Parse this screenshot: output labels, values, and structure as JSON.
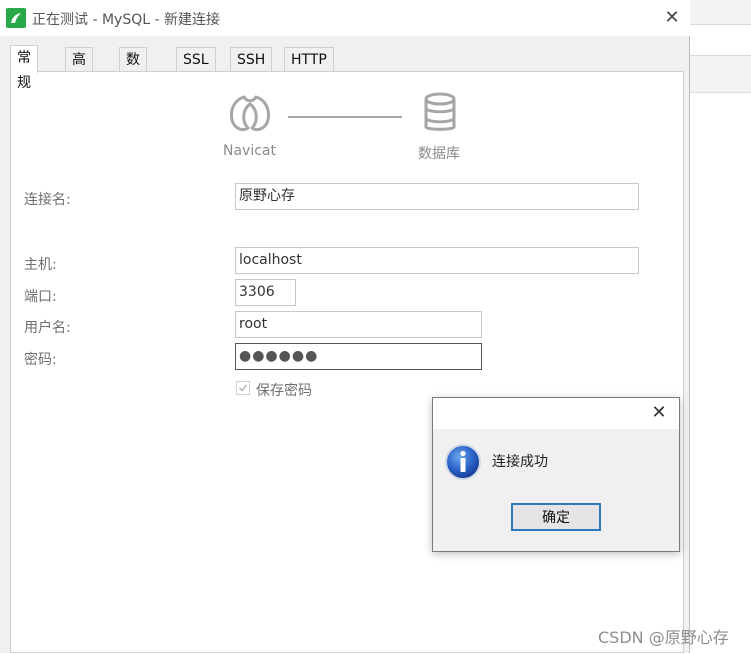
{
  "window": {
    "title": "正在测试 - MySQL - 新建连接"
  },
  "tabs": [
    {
      "label": "常规",
      "active": true
    },
    {
      "label": "高级",
      "active": false
    },
    {
      "label": "数据库",
      "active": false
    },
    {
      "label": "SSL",
      "active": false
    },
    {
      "label": "SSH",
      "active": false
    },
    {
      "label": "HTTP",
      "active": false
    }
  ],
  "diagram": {
    "left_caption": "Navicat",
    "right_caption": "数据库",
    "left_icon": "navicat-icon",
    "right_icon": "database-icon"
  },
  "form": {
    "connection_name_label": "连接名:",
    "connection_name_value": "原野心存",
    "host_label": "主机:",
    "host_value": "localhost",
    "port_label": "端口:",
    "port_value": "3306",
    "username_label": "用户名:",
    "username_value": "root",
    "password_label": "密码:",
    "password_value": "●●●●●●",
    "save_password_label": "保存密码",
    "save_password_checked": true
  },
  "dialog": {
    "message": "连接成功",
    "ok_label": "确定",
    "icon": "info-icon"
  },
  "watermark": "CSDN @原野心存",
  "colors": {
    "accent": "#2b79c2",
    "app_icon": "#2aa84a",
    "icon_gray": "#a6a6a6"
  }
}
